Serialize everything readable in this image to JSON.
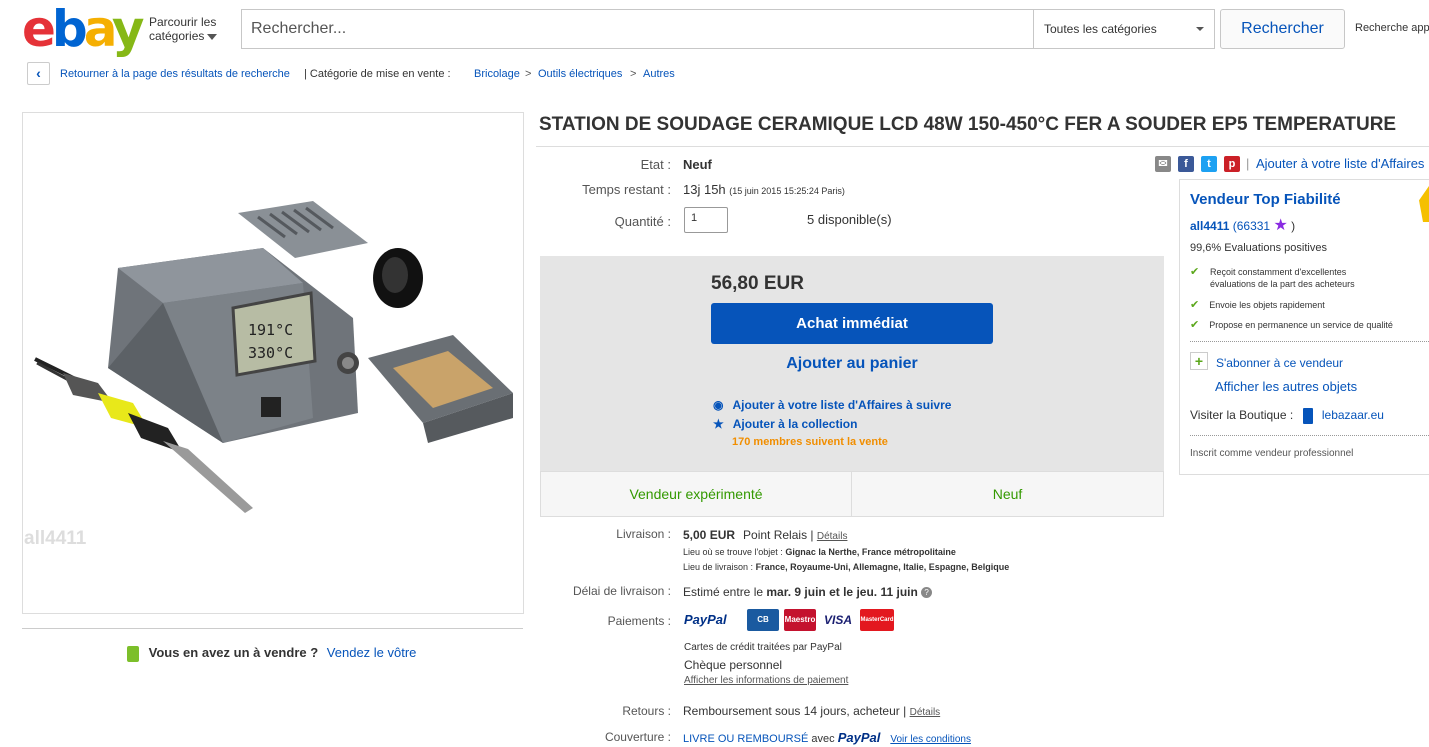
{
  "header": {
    "logo": {
      "e": "e",
      "b": "b",
      "a": "a",
      "y": "y"
    },
    "browse_line1": "Parcourir les",
    "browse_line2": "catégories",
    "search_placeholder": "Rechercher...",
    "category_select": "Toutes les catégories",
    "search_button": "Rechercher",
    "advanced_search": "Recherche app"
  },
  "breadcrumb": {
    "back_label": "Retourner à la page des résultats de recherche",
    "category_prefix": "| Catégorie de mise en vente :",
    "items": [
      "Bricolage",
      "Outils électriques",
      "Autres"
    ],
    "separator": ">"
  },
  "image": {
    "watermark": "all4411",
    "lcd_line1": "191°C",
    "lcd_line2": "330°C"
  },
  "sell_note": {
    "question": "Vous en avez un à vendre ?",
    "link": "Vendez le vôtre"
  },
  "product": {
    "title": "STATION DE SOUDAGE CERAMIQUE LCD 48W 150-450°C FER A SOUDER EP5 TEMPERATURE",
    "condition_label": "Etat :",
    "condition": "Neuf",
    "time_label": "Temps restant :",
    "time_left": "13j 15h",
    "time_detail": "(15 juin 2015   15:25:24 Paris)",
    "qty_label": "Quantité :",
    "qty_value": "1",
    "available": "5 disponible(s)",
    "price": "56,80 EUR",
    "buy_now": "Achat immédiat",
    "add_to_cart": "Ajouter au panier",
    "watch_link": "Ajouter à votre liste d'Affaires à suivre",
    "collection_link": "Ajouter à la collection",
    "members_watching": "170 membres suivent la vente",
    "badge_seller": "Vendeur expérimenté",
    "badge_condition": "Neuf"
  },
  "shipping": {
    "label": "Livraison :",
    "cost": "5,00 EUR",
    "method": "Point Relais",
    "details_sep": "|",
    "details_link": "Détails",
    "item_location_label": "Lieu où se trouve l'objet :",
    "item_location": "Gignac la Nerthe, France métropolitaine",
    "ships_to_label": "Lieu de livraison :",
    "ships_to": "France, Royaume-Uni, Allemagne, Italie, Espagne, Belgique"
  },
  "delivery": {
    "label": "Délai de livraison :",
    "text_prefix": "Estimé entre le",
    "date_from": "mar. 9 juin",
    "text_mid": "et le",
    "date_to": "jeu. 11 juin",
    "help_icon": "?"
  },
  "payments": {
    "label": "Paiements :",
    "paypal": "PayPal",
    "cards": [
      "CB",
      "Maestro",
      "VISA",
      "MasterCard"
    ],
    "card_note": "Cartes de crédit traitées par PayPal",
    "cheque": "Chèque personnel",
    "info_link": "Afficher les informations de paiement"
  },
  "returns": {
    "label": "Retours :",
    "text": "Remboursement sous 14 jours, acheteur",
    "sep": "|",
    "details_link": "Détails"
  },
  "coverage": {
    "label": "Couverture :",
    "text": "LIVRE OU REMBOURSÉ",
    "with": "avec",
    "paypal": "PayPal",
    "conditions_link": "Voir les conditions"
  },
  "share": {
    "watch_list_link": "Ajouter à votre liste d'Affaires"
  },
  "seller": {
    "badge_title": "Vendeur Top Fiabilité",
    "name": "all4411",
    "score": "(66331",
    "score_close": ")",
    "positive": "99,6% Evaluations positives",
    "points": [
      "Reçoit constamment d'excellentes évaluations de la part des acheteurs",
      "Envoie les objets rapidement",
      "Propose en permanence un service de qualité"
    ],
    "subscribe": "S'abonner à ce vendeur",
    "other_items": "Afficher les autres objets",
    "shop_label": "Visiter la Boutique :",
    "shop_name": "lebazaar.eu",
    "pro_note": "Inscrit comme vendeur professionnel"
  },
  "colors": {
    "accent": "#0654ba",
    "green": "#339900",
    "orange": "#f18e00"
  }
}
